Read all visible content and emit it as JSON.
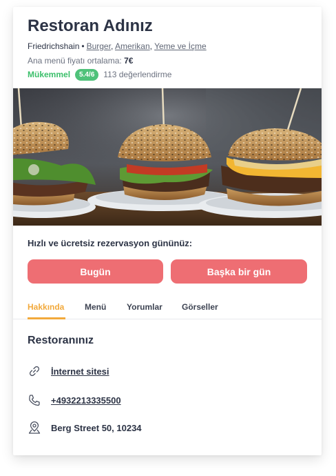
{
  "restaurant": {
    "name": "Restoran Adınız",
    "district": "Friedrichshain",
    "separator": "•",
    "categories": [
      "Burger",
      "Amerikan",
      "Yeme ve İçme"
    ],
    "average_price_label": "Ana menü fiyatı ortalama:",
    "average_price_value": "7€",
    "rating_label": "Mükemmel",
    "rating_score": "5.4/6",
    "reviews_text": "113 değerlendirme"
  },
  "reservation": {
    "prompt": "Hızlı ve ücretsiz rezervasyon gününüz:",
    "today_label": "Bugün",
    "other_day_label": "Başka bir gün"
  },
  "tabs": [
    {
      "label": "Hakkında",
      "active": true
    },
    {
      "label": "Menü",
      "active": false
    },
    {
      "label": "Yorumlar",
      "active": false
    },
    {
      "label": "Görseller",
      "active": false
    }
  ],
  "about": {
    "section_title": "Restoranınız",
    "website_label": "İnternet sitesi",
    "phone": "+4932213335500",
    "address": "Berg Street 50, 10234"
  },
  "colors": {
    "accent_tab": "#f2a93b",
    "button": "#ee6e73",
    "rating_green": "#4fc27a"
  },
  "icons": [
    "link-icon",
    "phone-icon",
    "location-pin-icon"
  ]
}
